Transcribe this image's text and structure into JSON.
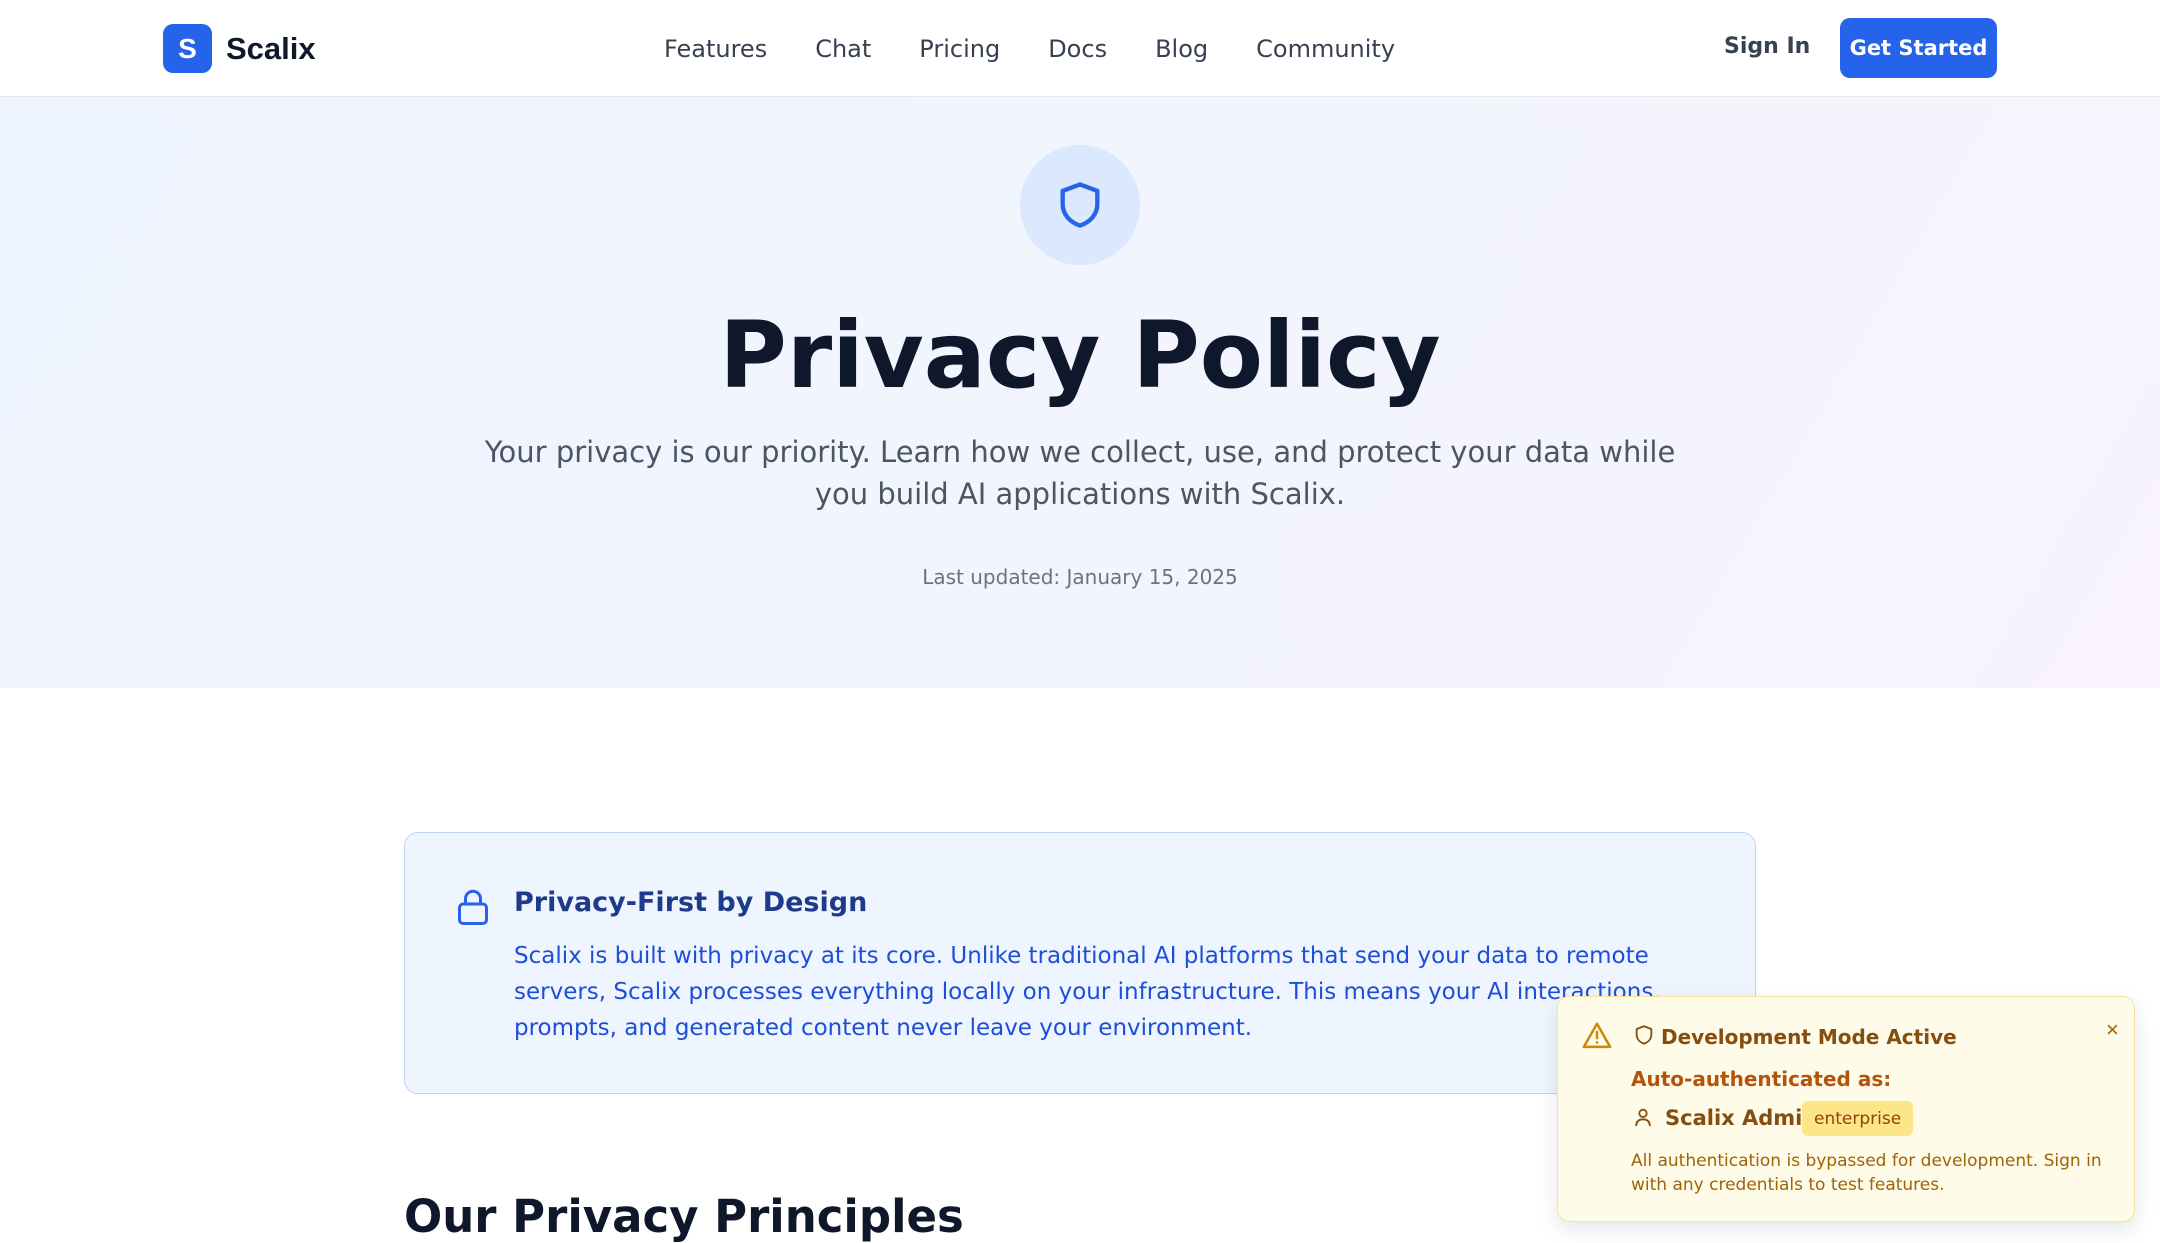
{
  "brand": {
    "mark": "S",
    "name": "Scalix"
  },
  "nav": {
    "items": [
      "Features",
      "Chat",
      "Pricing",
      "Docs",
      "Blog",
      "Community"
    ],
    "sign_in": "Sign In",
    "get_started": "Get Started"
  },
  "hero": {
    "icon": "shield-icon",
    "title": "Privacy Policy",
    "subtitle": "Your privacy is our priority. Learn how we collect, use, and protect your data while you build AI applications with Scalix.",
    "last_updated": "Last updated: January 15, 2025"
  },
  "callout": {
    "icon": "lock-icon",
    "title": "Privacy-First by Design",
    "body": "Scalix is built with privacy at its core. Unlike traditional AI platforms that send your data to remote servers, Scalix processes everything locally on your infrastructure. This means your AI interactions, prompts, and generated content never leave your environment."
  },
  "section": {
    "heading": "Our Privacy Principles"
  },
  "dev_toast": {
    "title": "Development Mode Active",
    "auth_label": "Auto-authenticated as:",
    "user_name": "Scalix Admin",
    "plan_badge": "enterprise",
    "note": "All authentication is bypassed for development. Sign in with any credentials to test features.",
    "close_label": "×"
  },
  "colors": {
    "accent": "#2563eb",
    "toast_bg": "#fefbe8",
    "toast_text": "#854d0e"
  }
}
